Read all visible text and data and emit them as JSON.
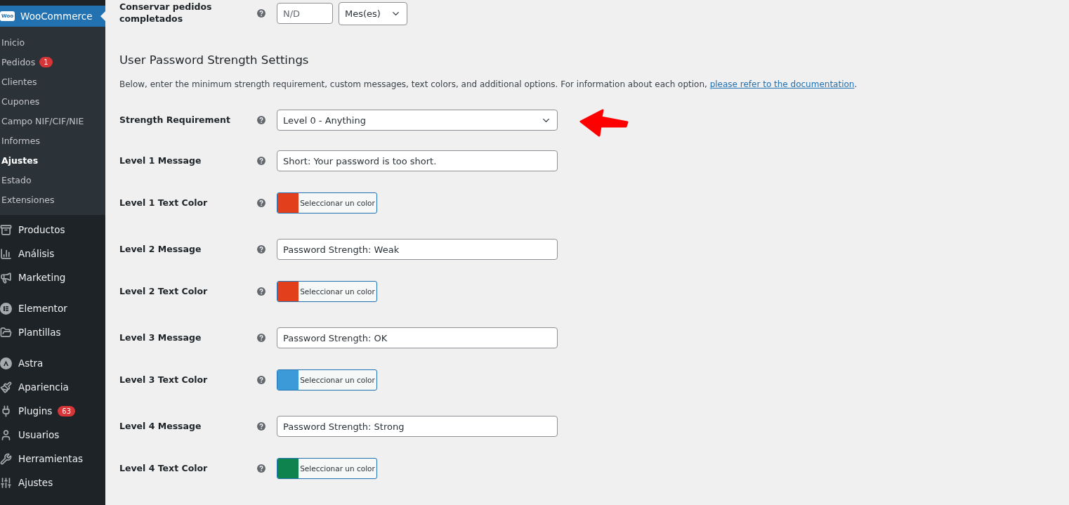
{
  "sidebar": {
    "parent": {
      "label": "WooCommerce",
      "logo": "Woo"
    },
    "submenu": [
      {
        "label": "Inicio",
        "selected": false
      },
      {
        "label": "Pedidos",
        "selected": false,
        "badge": "1"
      },
      {
        "label": "Clientes",
        "selected": false
      },
      {
        "label": "Cupones",
        "selected": false
      },
      {
        "label": "Campo NIF/CIF/NIE",
        "selected": false
      },
      {
        "label": "Informes",
        "selected": false
      },
      {
        "label": "Ajustes",
        "selected": true
      },
      {
        "label": "Estado",
        "selected": false
      },
      {
        "label": "Extensiones",
        "selected": false
      }
    ],
    "menu_groups": [
      [
        {
          "label": "Productos"
        },
        {
          "label": "Análisis"
        },
        {
          "label": "Marketing"
        }
      ],
      [
        {
          "label": "Elementor"
        },
        {
          "label": "Plantillas"
        }
      ],
      [
        {
          "label": "Astra"
        },
        {
          "label": "Apariencia"
        },
        {
          "label": "Plugins",
          "badge": "63"
        },
        {
          "label": "Usuarios"
        },
        {
          "label": "Herramientas"
        },
        {
          "label": "Ajustes"
        }
      ]
    ]
  },
  "retain_row": {
    "label": "Conservar pedidos completados",
    "placeholder": "N/D",
    "unit": "Mes(es)"
  },
  "section": {
    "title": "User Password Strength Settings",
    "description": "Below, enter the minimum strength requirement, custom messages, text colors, and additional options. For information about each option, ",
    "link": "please refer to the documentation",
    "after_link": "."
  },
  "settings": [
    {
      "kind": "select",
      "label": "Strength Requirement",
      "value": "Level 0 - Anything"
    },
    {
      "kind": "text",
      "label": "Level 1 Message",
      "value": "Short: Your password is too short."
    },
    {
      "kind": "color",
      "label": "Level 1 Text Color",
      "color": "#e2401c",
      "button": "Seleccionar un color"
    },
    {
      "kind": "text",
      "label": "Level 2 Message",
      "value": "Password Strength: Weak"
    },
    {
      "kind": "color",
      "label": "Level 2 Text Color",
      "color": "#e2401c",
      "button": "Seleccionar un color"
    },
    {
      "kind": "text",
      "label": "Level 3 Message",
      "value": "Password Strength: OK"
    },
    {
      "kind": "color",
      "label": "Level 3 Text Color",
      "color": "#3c9ad8",
      "button": "Seleccionar un color"
    },
    {
      "kind": "text",
      "label": "Level 4 Message",
      "value": "Password Strength: Strong"
    },
    {
      "kind": "color",
      "label": "Level 4 Text Color",
      "color": "#0f834d",
      "button": "Seleccionar un color"
    }
  ]
}
